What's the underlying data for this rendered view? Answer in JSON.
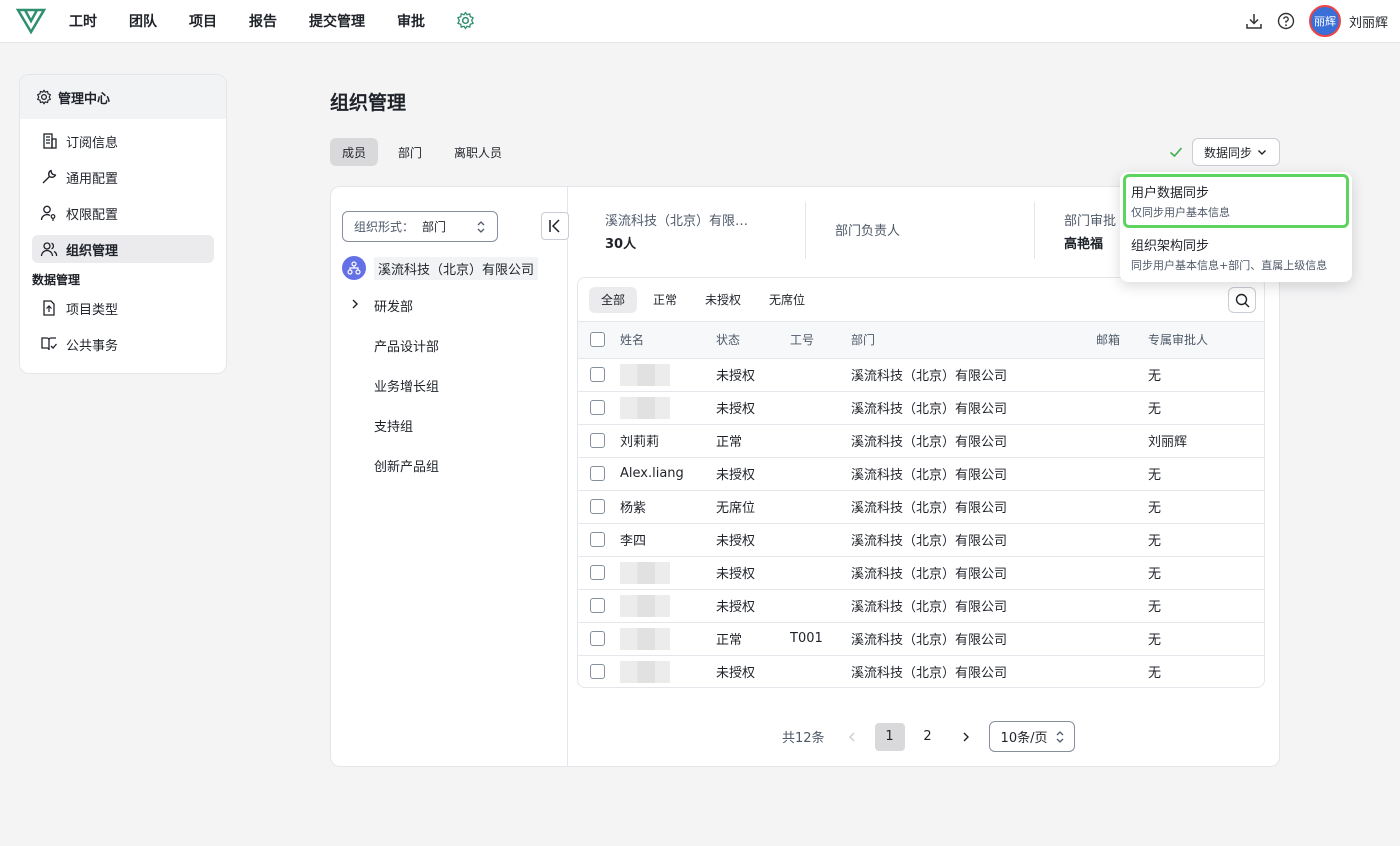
{
  "nav": {
    "items": [
      "工时",
      "团队",
      "项目",
      "报告",
      "提交管理",
      "审批"
    ]
  },
  "user": {
    "avatar_text": "丽辉",
    "name": "刘丽辉"
  },
  "sidebar": {
    "header": "管理中心",
    "items": [
      {
        "label": "订阅信息",
        "icon": "building-icon"
      },
      {
        "label": "通用配置",
        "icon": "wrench-icon"
      },
      {
        "label": "权限配置",
        "icon": "user-key-icon"
      },
      {
        "label": "组织管理",
        "icon": "users-icon",
        "active": true
      }
    ],
    "group": "数据管理",
    "group_items": [
      {
        "label": "项目类型",
        "icon": "file-icon"
      },
      {
        "label": "公共事务",
        "icon": "book-icon"
      }
    ]
  },
  "main": {
    "title": "组织管理",
    "tabs": [
      "成员",
      "部门",
      "离职人员"
    ],
    "sync_button": "数据同步"
  },
  "tree": {
    "select_label": "组织形式：",
    "select_value": "部门",
    "root": "溪流科技（北京）有限公司",
    "items": [
      "研发部",
      "产品设计部",
      "业务增长组",
      "支持组",
      "创新产品组"
    ]
  },
  "summary": {
    "company": "溪流科技（北京）有限…",
    "count": "30人",
    "leader_label": "部门负责人",
    "approver_label": "部门审批",
    "approver_value": "高艳福"
  },
  "filters": [
    "全部",
    "正常",
    "未授权",
    "无席位"
  ],
  "table": {
    "headers": [
      "姓名",
      "状态",
      "工号",
      "部门",
      "邮箱",
      "专属审批人"
    ],
    "rows": [
      {
        "name": "",
        "status": "未授权",
        "id": "",
        "dept": "溪流科技（北京）有限公司",
        "email": "",
        "approver": "无"
      },
      {
        "name": "",
        "status": "未授权",
        "id": "",
        "dept": "溪流科技（北京）有限公司",
        "email": "",
        "approver": "无"
      },
      {
        "name": "刘莉莉",
        "status": "正常",
        "id": "",
        "dept": "溪流科技（北京）有限公司",
        "email": "",
        "approver": "刘丽辉"
      },
      {
        "name": "Alex.liang",
        "status": "未授权",
        "id": "",
        "dept": "溪流科技（北京）有限公司",
        "email": "",
        "approver": "无"
      },
      {
        "name": "杨紫",
        "status": "无席位",
        "id": "",
        "dept": "溪流科技（北京）有限公司",
        "email": "",
        "approver": "无"
      },
      {
        "name": "李四",
        "status": "未授权",
        "id": "",
        "dept": "溪流科技（北京）有限公司",
        "email": "",
        "approver": "无"
      },
      {
        "name": "",
        "status": "未授权",
        "id": "",
        "dept": "溪流科技（北京）有限公司",
        "email": "",
        "approver": "无"
      },
      {
        "name": "",
        "status": "未授权",
        "id": "",
        "dept": "溪流科技（北京）有限公司",
        "email": "",
        "approver": "无"
      },
      {
        "name": "",
        "status": "正常",
        "id": "T001",
        "dept": "溪流科技（北京）有限公司",
        "email": "",
        "approver": "无"
      },
      {
        "name": "",
        "status": "未授权",
        "id": "",
        "dept": "溪流科技（北京）有限公司",
        "email": "",
        "approver": "无"
      }
    ]
  },
  "pager": {
    "total": "共12条",
    "pages": [
      "1",
      "2"
    ],
    "current": "1",
    "page_size": "10条/页"
  },
  "dropdown": {
    "items": [
      {
        "title": "用户数据同步",
        "desc": "仅同步用户基本信息"
      },
      {
        "title": "组织架构同步",
        "desc": "同步用户基本信息+部门、直属上级信息"
      }
    ]
  },
  "colors": {
    "accent": "#5fd35f",
    "logo": "#2f8f6e",
    "avatar": "#3b6fd8"
  }
}
